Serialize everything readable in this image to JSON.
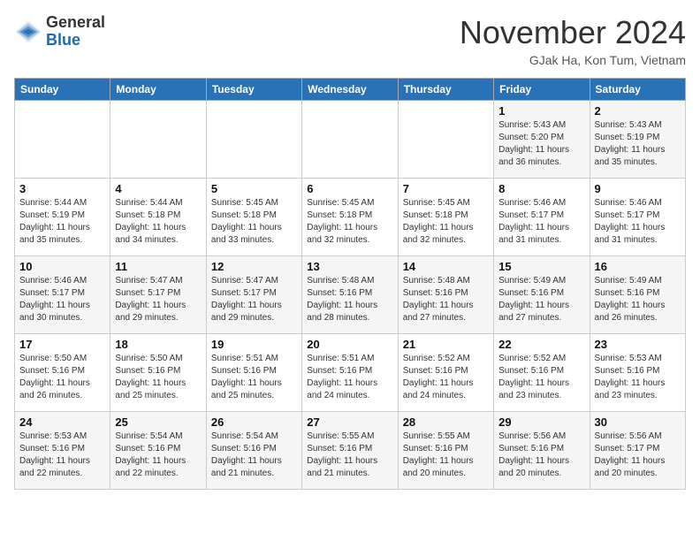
{
  "header": {
    "logo_general": "General",
    "logo_blue": "Blue",
    "month_title": "November 2024",
    "location": "GJak Ha, Kon Tum, Vietnam"
  },
  "weekdays": [
    "Sunday",
    "Monday",
    "Tuesday",
    "Wednesday",
    "Thursday",
    "Friday",
    "Saturday"
  ],
  "weeks": [
    [
      {
        "day": "",
        "info": ""
      },
      {
        "day": "",
        "info": ""
      },
      {
        "day": "",
        "info": ""
      },
      {
        "day": "",
        "info": ""
      },
      {
        "day": "",
        "info": ""
      },
      {
        "day": "1",
        "info": "Sunrise: 5:43 AM\nSunset: 5:20 PM\nDaylight: 11 hours\nand 36 minutes."
      },
      {
        "day": "2",
        "info": "Sunrise: 5:43 AM\nSunset: 5:19 PM\nDaylight: 11 hours\nand 35 minutes."
      }
    ],
    [
      {
        "day": "3",
        "info": "Sunrise: 5:44 AM\nSunset: 5:19 PM\nDaylight: 11 hours\nand 35 minutes."
      },
      {
        "day": "4",
        "info": "Sunrise: 5:44 AM\nSunset: 5:18 PM\nDaylight: 11 hours\nand 34 minutes."
      },
      {
        "day": "5",
        "info": "Sunrise: 5:45 AM\nSunset: 5:18 PM\nDaylight: 11 hours\nand 33 minutes."
      },
      {
        "day": "6",
        "info": "Sunrise: 5:45 AM\nSunset: 5:18 PM\nDaylight: 11 hours\nand 32 minutes."
      },
      {
        "day": "7",
        "info": "Sunrise: 5:45 AM\nSunset: 5:18 PM\nDaylight: 11 hours\nand 32 minutes."
      },
      {
        "day": "8",
        "info": "Sunrise: 5:46 AM\nSunset: 5:17 PM\nDaylight: 11 hours\nand 31 minutes."
      },
      {
        "day": "9",
        "info": "Sunrise: 5:46 AM\nSunset: 5:17 PM\nDaylight: 11 hours\nand 31 minutes."
      }
    ],
    [
      {
        "day": "10",
        "info": "Sunrise: 5:46 AM\nSunset: 5:17 PM\nDaylight: 11 hours\nand 30 minutes."
      },
      {
        "day": "11",
        "info": "Sunrise: 5:47 AM\nSunset: 5:17 PM\nDaylight: 11 hours\nand 29 minutes."
      },
      {
        "day": "12",
        "info": "Sunrise: 5:47 AM\nSunset: 5:17 PM\nDaylight: 11 hours\nand 29 minutes."
      },
      {
        "day": "13",
        "info": "Sunrise: 5:48 AM\nSunset: 5:16 PM\nDaylight: 11 hours\nand 28 minutes."
      },
      {
        "day": "14",
        "info": "Sunrise: 5:48 AM\nSunset: 5:16 PM\nDaylight: 11 hours\nand 27 minutes."
      },
      {
        "day": "15",
        "info": "Sunrise: 5:49 AM\nSunset: 5:16 PM\nDaylight: 11 hours\nand 27 minutes."
      },
      {
        "day": "16",
        "info": "Sunrise: 5:49 AM\nSunset: 5:16 PM\nDaylight: 11 hours\nand 26 minutes."
      }
    ],
    [
      {
        "day": "17",
        "info": "Sunrise: 5:50 AM\nSunset: 5:16 PM\nDaylight: 11 hours\nand 26 minutes."
      },
      {
        "day": "18",
        "info": "Sunrise: 5:50 AM\nSunset: 5:16 PM\nDaylight: 11 hours\nand 25 minutes."
      },
      {
        "day": "19",
        "info": "Sunrise: 5:51 AM\nSunset: 5:16 PM\nDaylight: 11 hours\nand 25 minutes."
      },
      {
        "day": "20",
        "info": "Sunrise: 5:51 AM\nSunset: 5:16 PM\nDaylight: 11 hours\nand 24 minutes."
      },
      {
        "day": "21",
        "info": "Sunrise: 5:52 AM\nSunset: 5:16 PM\nDaylight: 11 hours\nand 24 minutes."
      },
      {
        "day": "22",
        "info": "Sunrise: 5:52 AM\nSunset: 5:16 PM\nDaylight: 11 hours\nand 23 minutes."
      },
      {
        "day": "23",
        "info": "Sunrise: 5:53 AM\nSunset: 5:16 PM\nDaylight: 11 hours\nand 23 minutes."
      }
    ],
    [
      {
        "day": "24",
        "info": "Sunrise: 5:53 AM\nSunset: 5:16 PM\nDaylight: 11 hours\nand 22 minutes."
      },
      {
        "day": "25",
        "info": "Sunrise: 5:54 AM\nSunset: 5:16 PM\nDaylight: 11 hours\nand 22 minutes."
      },
      {
        "day": "26",
        "info": "Sunrise: 5:54 AM\nSunset: 5:16 PM\nDaylight: 11 hours\nand 21 minutes."
      },
      {
        "day": "27",
        "info": "Sunrise: 5:55 AM\nSunset: 5:16 PM\nDaylight: 11 hours\nand 21 minutes."
      },
      {
        "day": "28",
        "info": "Sunrise: 5:55 AM\nSunset: 5:16 PM\nDaylight: 11 hours\nand 20 minutes."
      },
      {
        "day": "29",
        "info": "Sunrise: 5:56 AM\nSunset: 5:16 PM\nDaylight: 11 hours\nand 20 minutes."
      },
      {
        "day": "30",
        "info": "Sunrise: 5:56 AM\nSunset: 5:17 PM\nDaylight: 11 hours\nand 20 minutes."
      }
    ]
  ]
}
